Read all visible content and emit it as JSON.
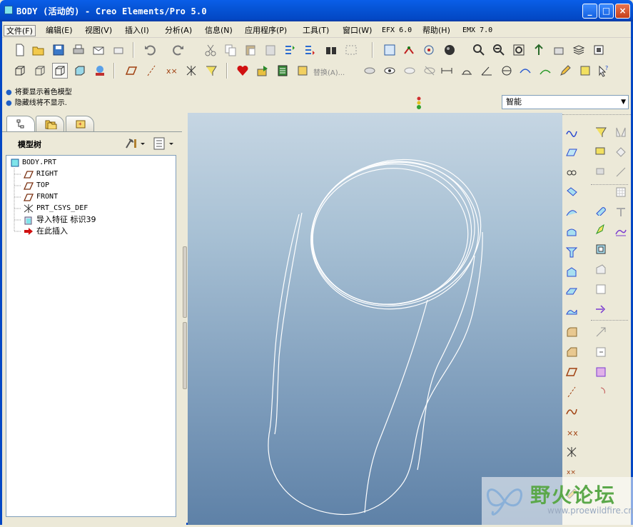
{
  "window": {
    "title": "BODY (活动的) - Creo Elements/Pro 5.0",
    "minimize_glyph": "_",
    "maximize_glyph": "□",
    "close_glyph": "×"
  },
  "menu": [
    {
      "label": "文件(F)"
    },
    {
      "label": "编辑(E)"
    },
    {
      "label": "视图(V)"
    },
    {
      "label": "插入(I)"
    },
    {
      "label": "分析(A)"
    },
    {
      "label": "信息(N)"
    },
    {
      "label": "应用程序(P)"
    },
    {
      "label": "工具(T)"
    },
    {
      "label": "窗口(W)"
    },
    {
      "label": "EFX 6.0"
    },
    {
      "label": "帮助(H)"
    },
    {
      "label": "EMX 7.0"
    }
  ],
  "toolbar": {
    "replace_label": "替换(A)..."
  },
  "messages": [
    "将要显示着色模型",
    "隐藏线将不显示."
  ],
  "selection_filter": {
    "value": "智能"
  },
  "panel": {
    "title": "模型树"
  },
  "tree": {
    "items": [
      {
        "label": "BODY.PRT",
        "icon": "part-icon"
      },
      {
        "label": "RIGHT",
        "icon": "datum-plane-icon"
      },
      {
        "label": "TOP",
        "icon": "datum-plane-icon"
      },
      {
        "label": "FRONT",
        "icon": "datum-plane-icon"
      },
      {
        "label": "PRT_CSYS_DEF",
        "icon": "csys-icon"
      },
      {
        "label": "导入特征 标识39",
        "icon": "import-feature-icon"
      },
      {
        "label": "在此插入",
        "icon": "insert-here-arrow-icon"
      }
    ]
  },
  "watermark": {
    "text": "野火论坛",
    "url": "www.proewildfire.cn"
  },
  "colors": {
    "titlebar": "#0654d6",
    "viewport_top": "#c6d6e3",
    "viewport_bottom": "#5e81a7",
    "curve": "#ffffff",
    "watermark_text": "#5ba84a"
  }
}
